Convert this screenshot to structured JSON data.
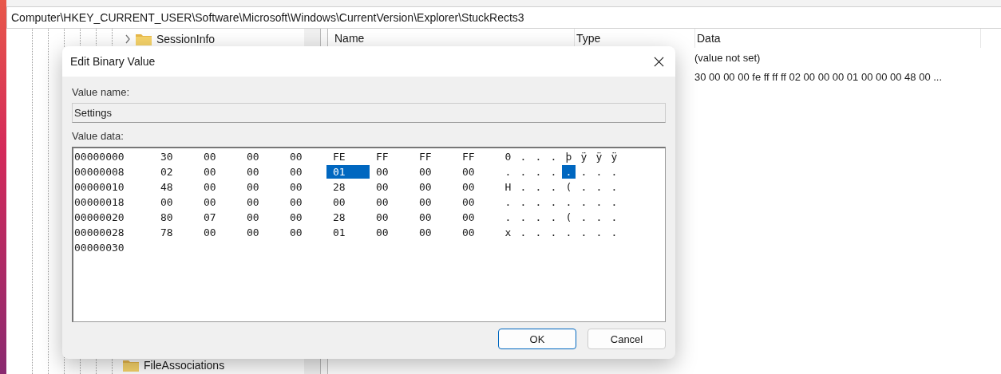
{
  "address_bar": {
    "path": "Computer\\HKEY_CURRENT_USER\\Software\\Microsoft\\Windows\\CurrentVersion\\Explorer\\StuckRects3"
  },
  "tree": {
    "items": [
      {
        "label": "SessionInfo",
        "expanded": false
      },
      {
        "label": "FileAssociations"
      }
    ]
  },
  "list": {
    "columns": [
      "Name",
      "Type",
      "Data"
    ],
    "rows": [
      {
        "data": "(value not set)"
      },
      {
        "data": "30 00 00 00 fe ff ff ff 02 00 00 00 01 00 00 00 48 00 ..."
      }
    ]
  },
  "dialog": {
    "title": "Edit Binary Value",
    "value_name_label": "Value name:",
    "value_name": "Settings",
    "value_data_label": "Value data:",
    "hex_rows": [
      {
        "address": "00000000",
        "bytes": [
          {
            "value": "30",
            "selected": false
          },
          {
            "value": "00",
            "selected": false
          },
          {
            "value": "00",
            "selected": false
          },
          {
            "value": "00",
            "selected": false
          },
          {
            "value": "FE",
            "selected": false
          },
          {
            "value": "FF",
            "selected": false
          },
          {
            "value": "FF",
            "selected": false
          },
          {
            "value": "FF",
            "selected": false
          }
        ],
        "ascii": [
          {
            "char": "0",
            "selected": false
          },
          {
            "char": ".",
            "selected": false
          },
          {
            "char": ".",
            "selected": false
          },
          {
            "char": ".",
            "selected": false
          },
          {
            "char": "þ",
            "selected": false
          },
          {
            "char": "ÿ",
            "selected": false
          },
          {
            "char": "ÿ",
            "selected": false
          },
          {
            "char": "ÿ",
            "selected": false
          }
        ]
      },
      {
        "address": "00000008",
        "bytes": [
          {
            "value": "02",
            "selected": false
          },
          {
            "value": "00",
            "selected": false
          },
          {
            "value": "00",
            "selected": false
          },
          {
            "value": "00",
            "selected": false
          },
          {
            "value": "01",
            "selected": true
          },
          {
            "value": "00",
            "selected": false
          },
          {
            "value": "00",
            "selected": false
          },
          {
            "value": "00",
            "selected": false
          }
        ],
        "ascii": [
          {
            "char": ".",
            "selected": false
          },
          {
            "char": ".",
            "selected": false
          },
          {
            "char": ".",
            "selected": false
          },
          {
            "char": ".",
            "selected": false
          },
          {
            "char": ".",
            "selected": true
          },
          {
            "char": ".",
            "selected": false
          },
          {
            "char": ".",
            "selected": false
          },
          {
            "char": ".",
            "selected": false
          }
        ]
      },
      {
        "address": "00000010",
        "bytes": [
          {
            "value": "48",
            "selected": false
          },
          {
            "value": "00",
            "selected": false
          },
          {
            "value": "00",
            "selected": false
          },
          {
            "value": "00",
            "selected": false
          },
          {
            "value": "28",
            "selected": false
          },
          {
            "value": "00",
            "selected": false
          },
          {
            "value": "00",
            "selected": false
          },
          {
            "value": "00",
            "selected": false
          }
        ],
        "ascii": [
          {
            "char": "H",
            "selected": false
          },
          {
            "char": ".",
            "selected": false
          },
          {
            "char": ".",
            "selected": false
          },
          {
            "char": ".",
            "selected": false
          },
          {
            "char": "(",
            "selected": false
          },
          {
            "char": ".",
            "selected": false
          },
          {
            "char": ".",
            "selected": false
          },
          {
            "char": ".",
            "selected": false
          }
        ]
      },
      {
        "address": "00000018",
        "bytes": [
          {
            "value": "00",
            "selected": false
          },
          {
            "value": "00",
            "selected": false
          },
          {
            "value": "00",
            "selected": false
          },
          {
            "value": "00",
            "selected": false
          },
          {
            "value": "00",
            "selected": false
          },
          {
            "value": "00",
            "selected": false
          },
          {
            "value": "00",
            "selected": false
          },
          {
            "value": "00",
            "selected": false
          }
        ],
        "ascii": [
          {
            "char": ".",
            "selected": false
          },
          {
            "char": ".",
            "selected": false
          },
          {
            "char": ".",
            "selected": false
          },
          {
            "char": ".",
            "selected": false
          },
          {
            "char": ".",
            "selected": false
          },
          {
            "char": ".",
            "selected": false
          },
          {
            "char": ".",
            "selected": false
          },
          {
            "char": ".",
            "selected": false
          }
        ]
      },
      {
        "address": "00000020",
        "bytes": [
          {
            "value": "80",
            "selected": false
          },
          {
            "value": "07",
            "selected": false
          },
          {
            "value": "00",
            "selected": false
          },
          {
            "value": "00",
            "selected": false
          },
          {
            "value": "28",
            "selected": false
          },
          {
            "value": "00",
            "selected": false
          },
          {
            "value": "00",
            "selected": false
          },
          {
            "value": "00",
            "selected": false
          }
        ],
        "ascii": [
          {
            "char": ".",
            "selected": false
          },
          {
            "char": ".",
            "selected": false
          },
          {
            "char": ".",
            "selected": false
          },
          {
            "char": ".",
            "selected": false
          },
          {
            "char": "(",
            "selected": false
          },
          {
            "char": ".",
            "selected": false
          },
          {
            "char": ".",
            "selected": false
          },
          {
            "char": ".",
            "selected": false
          }
        ]
      },
      {
        "address": "00000028",
        "bytes": [
          {
            "value": "78",
            "selected": false
          },
          {
            "value": "00",
            "selected": false
          },
          {
            "value": "00",
            "selected": false
          },
          {
            "value": "00",
            "selected": false
          },
          {
            "value": "01",
            "selected": false
          },
          {
            "value": "00",
            "selected": false
          },
          {
            "value": "00",
            "selected": false
          },
          {
            "value": "00",
            "selected": false
          }
        ],
        "ascii": [
          {
            "char": "x",
            "selected": false
          },
          {
            "char": ".",
            "selected": false
          },
          {
            "char": ".",
            "selected": false
          },
          {
            "char": ".",
            "selected": false
          },
          {
            "char": ".",
            "selected": false
          },
          {
            "char": ".",
            "selected": false
          },
          {
            "char": ".",
            "selected": false
          },
          {
            "char": ".",
            "selected": false
          }
        ]
      },
      {
        "address": "00000030"
      }
    ],
    "buttons": [
      {
        "label": "OK",
        "kind": "default"
      },
      {
        "label": "Cancel",
        "kind": "normal"
      }
    ]
  }
}
